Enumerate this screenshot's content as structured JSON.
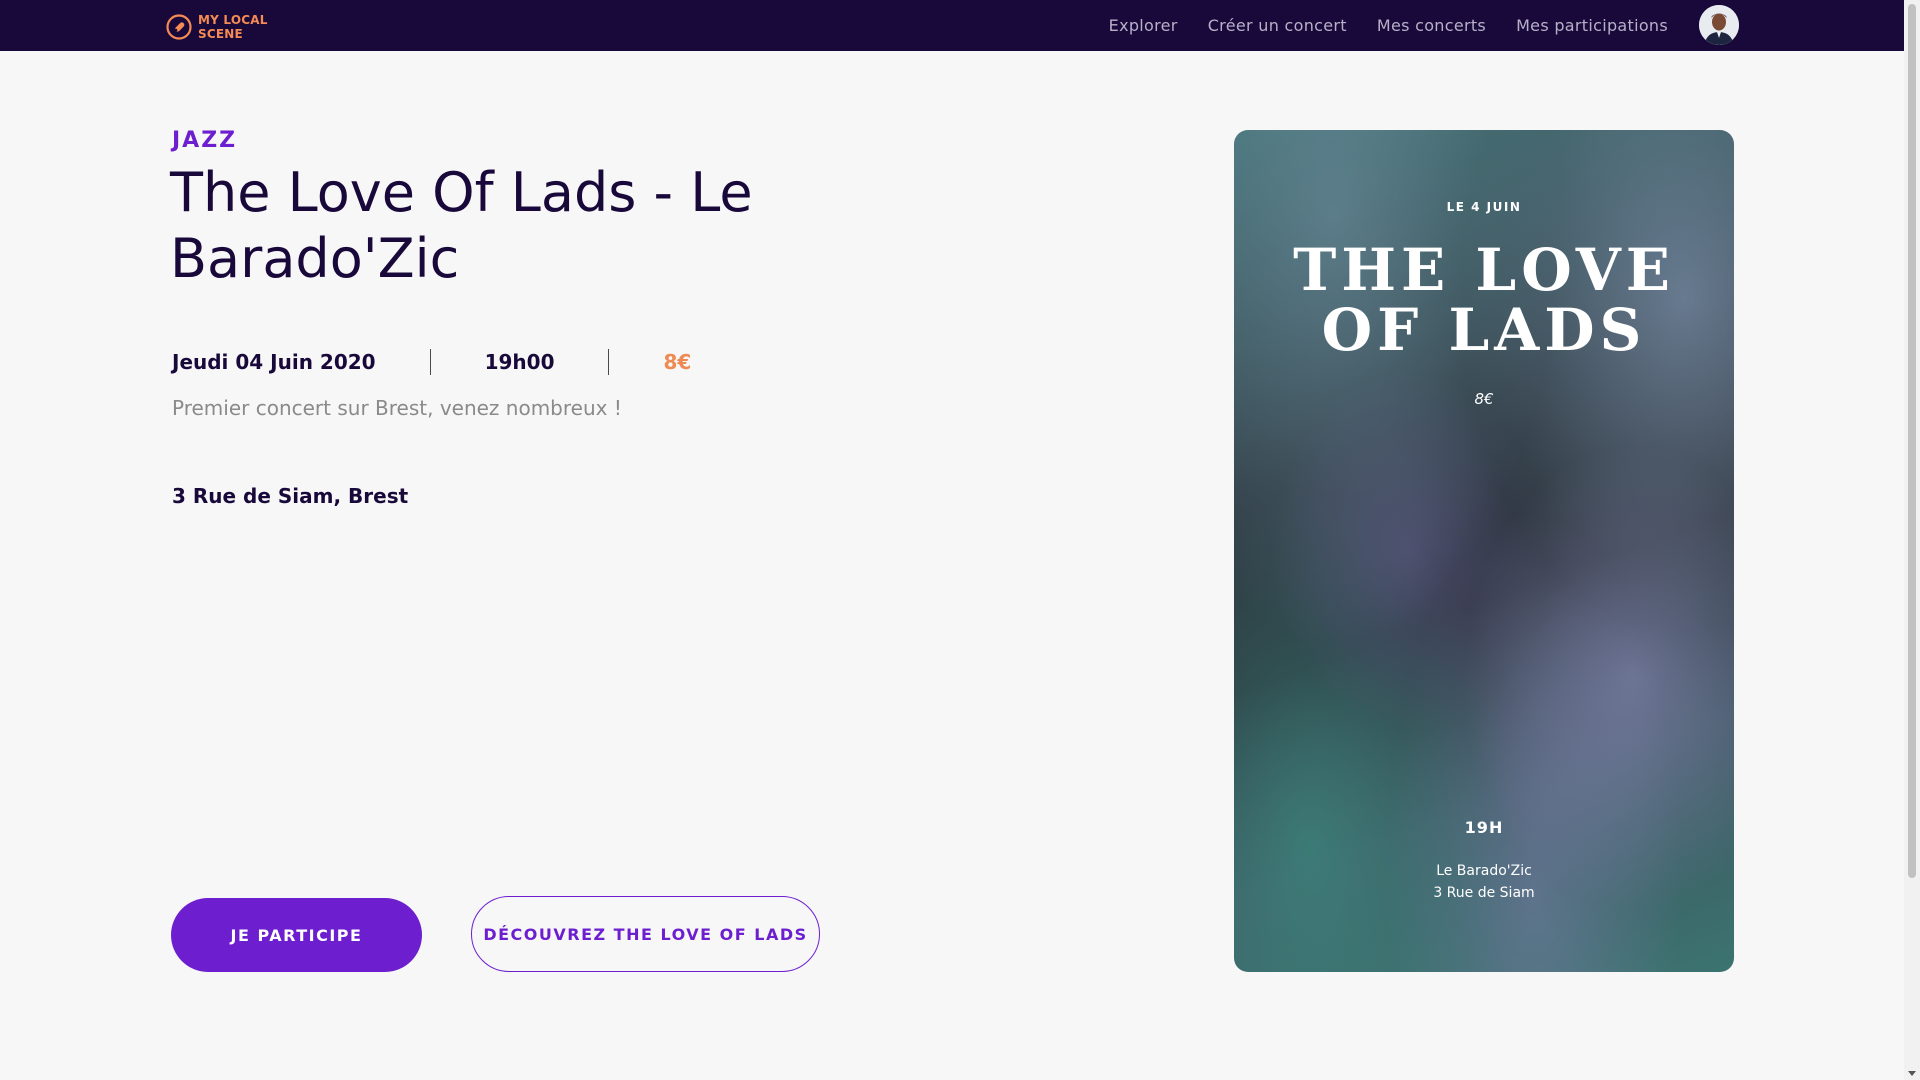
{
  "brand": {
    "logo_text": "MY LOCAL SCENE",
    "accent": "#f58a55",
    "nav_bg": "#19093a"
  },
  "nav": {
    "links": [
      "Explorer",
      "Créer un concert",
      "Mes concerts",
      "Mes participations"
    ]
  },
  "event": {
    "genre": "JAZZ",
    "title": "The Love Of Lads - Le Barado'Zic",
    "date": "Jeudi 04 Juin 2020",
    "time": "19h00",
    "price": "8€",
    "description": "Premier concert sur Brest, venez nombreux !",
    "address": "3 Rue de Siam, Brest"
  },
  "actions": {
    "participate_label": "JE PARTICIPE",
    "discover_label": "DÉCOUVREZ THE LOVE OF LADS"
  },
  "poster": {
    "date": "LE 4 JUIN",
    "title_line1": "THE LOVE",
    "title_line2": "OF LADS",
    "price": "8€",
    "time": "19H",
    "venue_line1": "Le Barado'Zic",
    "venue_line2": "3 Rue de Siam"
  },
  "colors": {
    "primary": "#6d1fd0",
    "price": "#ee8b55",
    "text_dark": "#19093a"
  }
}
